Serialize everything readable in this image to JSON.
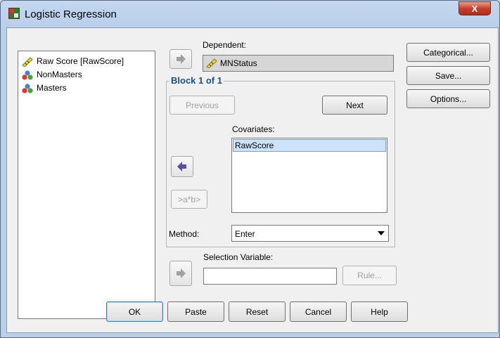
{
  "window": {
    "title": "Logistic Regression",
    "close_label": "X"
  },
  "variables": [
    {
      "label": "Raw Score [RawScore]",
      "icon": "scale-ruler-icon"
    },
    {
      "label": "NonMasters",
      "icon": "nominal-balls-icon"
    },
    {
      "label": "Masters",
      "icon": "nominal-balls-icon"
    }
  ],
  "dependent": {
    "label": "Dependent:",
    "value": "MNStatus"
  },
  "block": {
    "title": "Block 1 of 1",
    "previous": "Previous",
    "next": "Next",
    "covariates_label": "Covariates:",
    "covariates": [
      "RawScore"
    ],
    "interaction": ">a*b>",
    "method_label": "Method:",
    "method_value": "Enter"
  },
  "selection": {
    "label": "Selection Variable:",
    "value": "",
    "rule": "Rule..."
  },
  "side_buttons": {
    "categorical": "Categorical...",
    "save": "Save...",
    "options": "Options..."
  },
  "bottom_buttons": {
    "ok": "OK",
    "paste": "Paste",
    "reset": "Reset",
    "cancel": "Cancel",
    "help": "Help"
  },
  "colors": {
    "accent": "#1c4f8a",
    "selection": "#cde3fb",
    "arrow_active": "#5a4fa8",
    "close": "#c7402c"
  }
}
